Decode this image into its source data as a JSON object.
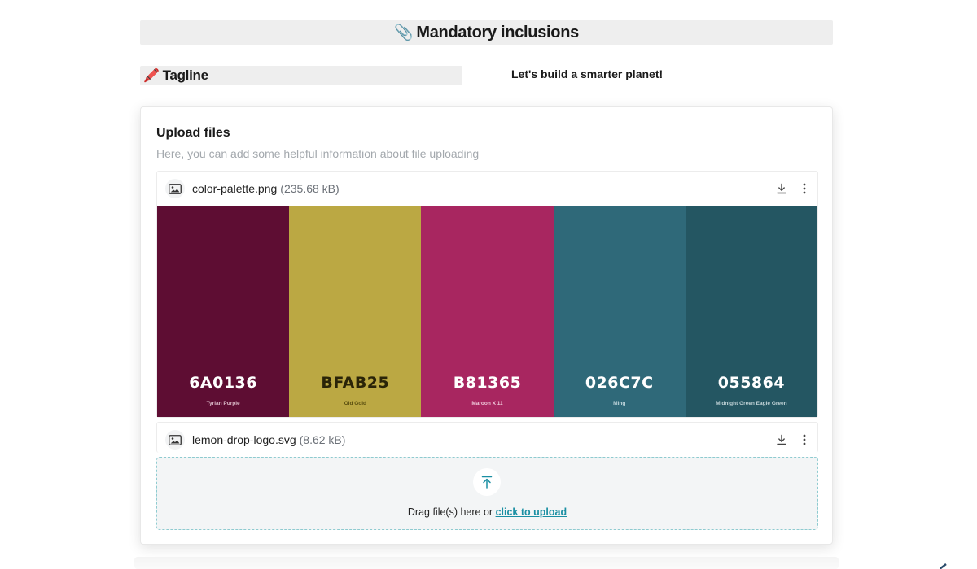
{
  "header": {
    "title": "Mandatory inclusions",
    "emoji": "📎"
  },
  "tagline": {
    "label": "Tagline",
    "emoji": "🖍️",
    "value": "Let's build a smarter planet!"
  },
  "upload": {
    "title": "Upload files",
    "help_text": "Here, you can add some helpful information about file uploading",
    "files": [
      {
        "name": "color-palette.png",
        "size": "(235.68 kB)",
        "icon": "image-icon"
      },
      {
        "name": "lemon-drop-logo.svg",
        "size": "(8.62 kB)",
        "icon": "image-icon"
      }
    ],
    "palette": [
      {
        "hex": "6A0136",
        "name": "Tyrian Purple",
        "bg": "#5E0D33",
        "fg": "#ffffff",
        "sub": "#d9b8c6"
      },
      {
        "hex": "BFAB25",
        "name": "Old Gold",
        "bg": "#BBA843",
        "fg": "#2a2408",
        "sub": "#5a4f10"
      },
      {
        "hex": "B81365",
        "name": "Maroon X 11",
        "bg": "#A82660",
        "fg": "#ffffff",
        "sub": "#eec6d8"
      },
      {
        "hex": "026C7C",
        "name": "Ming",
        "bg": "#2F6979",
        "fg": "#ffffff",
        "sub": "#c2d7dd"
      },
      {
        "hex": "055864",
        "name": "Midnight Green Eagle Green",
        "bg": "#245662",
        "fg": "#ffffff",
        "sub": "#c2d4d8"
      }
    ],
    "dropzone": {
      "text": "Drag file(s) here or",
      "link": "click to upload"
    }
  },
  "colors": {
    "accent": "#1a8fa3",
    "panel": "#eeeeee"
  }
}
